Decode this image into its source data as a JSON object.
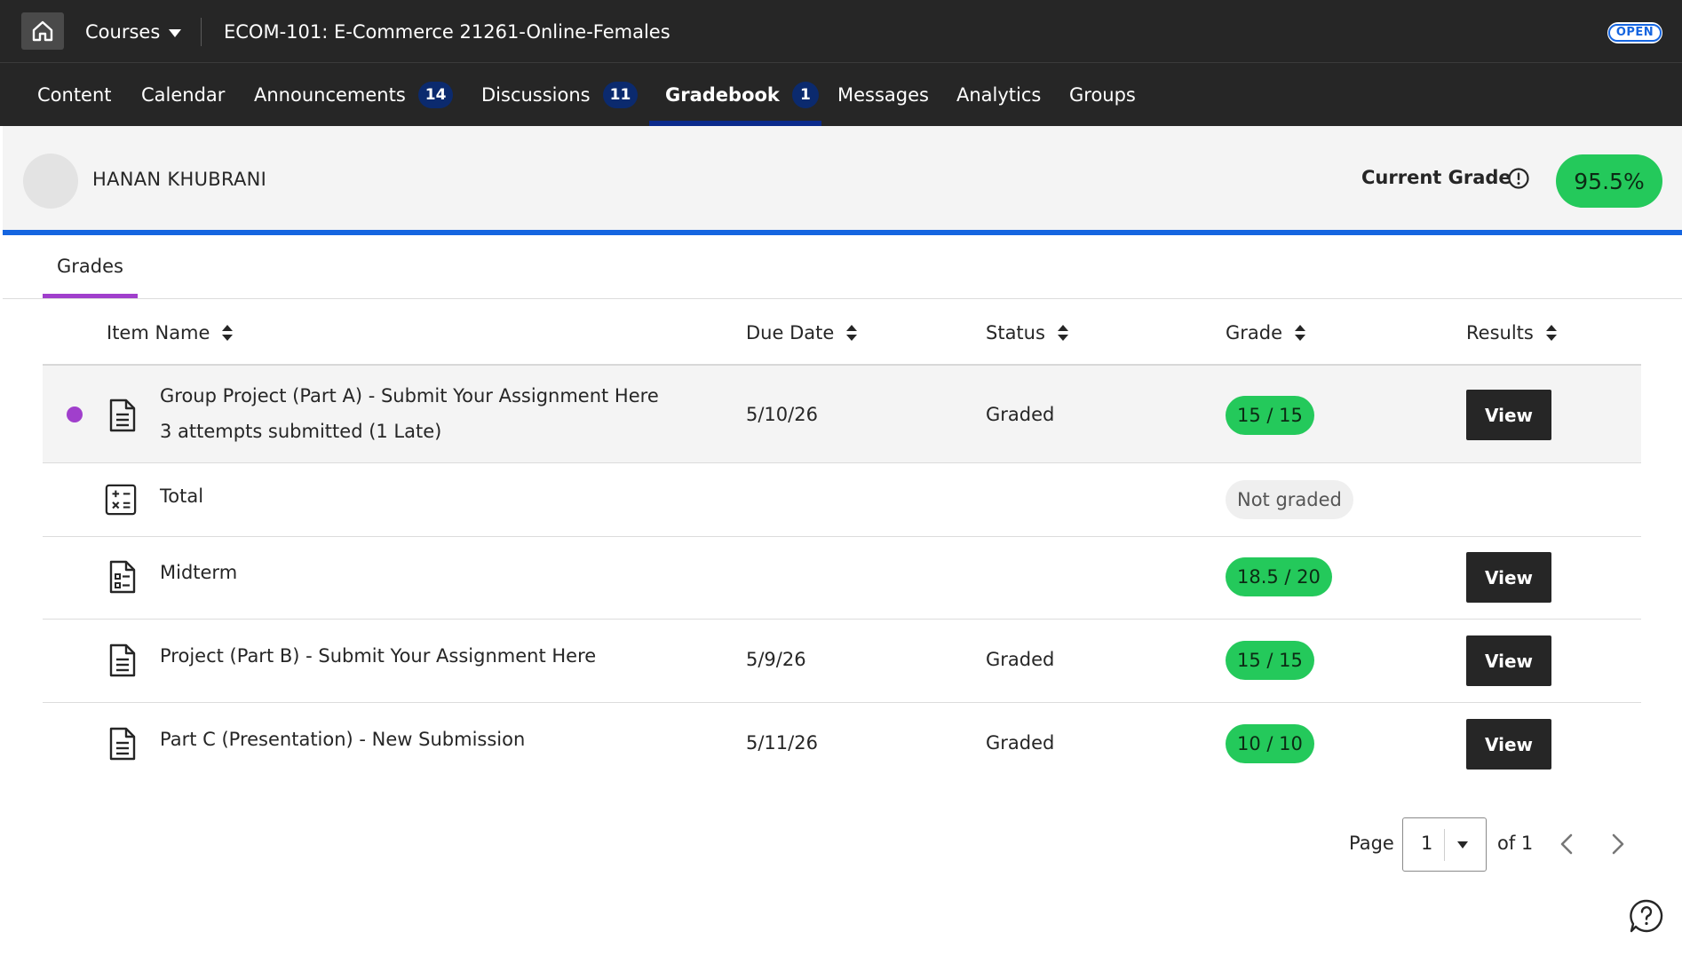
{
  "topbar": {
    "courses_label": "Courses",
    "course_title": "ECOM-101: E-Commerce 21261-Online-Females",
    "status_badge": "OPEN"
  },
  "nav": {
    "tabs": [
      {
        "label": "Content",
        "badge": null,
        "active": false
      },
      {
        "label": "Calendar",
        "badge": null,
        "active": false
      },
      {
        "label": "Announcements",
        "badge": "14",
        "active": false
      },
      {
        "label": "Discussions",
        "badge": "11",
        "active": false
      },
      {
        "label": "Gradebook",
        "badge": "1",
        "active": true
      },
      {
        "label": "Messages",
        "badge": null,
        "active": false
      },
      {
        "label": "Analytics",
        "badge": null,
        "active": false
      },
      {
        "label": "Groups",
        "badge": null,
        "active": false
      }
    ]
  },
  "student": {
    "name": "HANAN KHUBRANI",
    "current_grade_label": "Current Grade",
    "current_grade": "95.5%"
  },
  "subtabs": {
    "grades_label": "Grades"
  },
  "table": {
    "headers": {
      "item_name": "Item Name",
      "due_date": "Due Date",
      "status": "Status",
      "grade": "Grade",
      "results": "Results"
    },
    "rows": [
      {
        "name": "Group Project (Part A) - Submit Your Assignment Here",
        "subtext": "3 attempts submitted (1 Late)",
        "due_date": "5/10/26",
        "status": "Graded",
        "grade": "15 / 15",
        "results_label": "View",
        "unread": true,
        "icon": "assignment-icon"
      },
      {
        "name": "Total",
        "subtext": "",
        "due_date": "",
        "status": "",
        "grade": "Not graded",
        "results_label": "",
        "unread": false,
        "icon": "calculation-icon"
      },
      {
        "name": "Midterm",
        "subtext": "",
        "due_date": "",
        "status": "",
        "grade": "18.5 / 20",
        "results_label": "View",
        "unread": false,
        "icon": "test-icon"
      },
      {
        "name": "Project (Part B) - Submit Your Assignment Here",
        "subtext": "",
        "due_date": "5/9/26",
        "status": "Graded",
        "grade": "15 / 15",
        "results_label": "View",
        "unread": false,
        "icon": "assignment-icon"
      },
      {
        "name": "Part C (Presentation) - New Submission",
        "subtext": "",
        "due_date": "5/11/26",
        "status": "Graded",
        "grade": "10 / 10",
        "results_label": "View",
        "unread": false,
        "icon": "assignment-icon"
      }
    ]
  },
  "pagination": {
    "page_label": "Page",
    "current_page": "1",
    "of_label": "of 1"
  },
  "colors": {
    "dark_bar": "#262626",
    "grade_green": "#24c95b",
    "accent_blue": "#1565e0",
    "unread_purple": "#a03fcc",
    "badge_navy": "#0b2a6e"
  }
}
